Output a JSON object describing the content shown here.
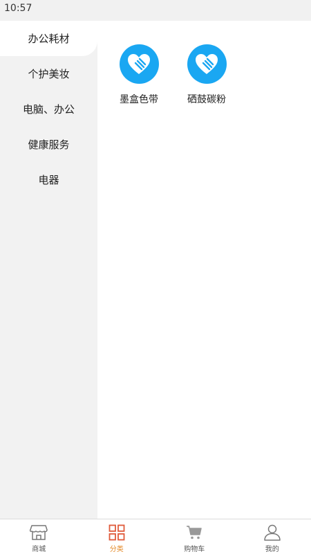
{
  "status_bar": {
    "time": "10:57"
  },
  "sidebar": {
    "items": [
      {
        "label": "办公耗材",
        "active": true
      },
      {
        "label": "个护美妆",
        "active": false
      },
      {
        "label": "电脑、办公",
        "active": false
      },
      {
        "label": "健康服务",
        "active": false
      },
      {
        "label": "电器",
        "active": false
      }
    ]
  },
  "content": {
    "categories": [
      {
        "label": "墨盒色带",
        "icon": "heart-hand-icon"
      },
      {
        "label": "硒鼓碳粉",
        "icon": "heart-hand-icon"
      }
    ]
  },
  "tabbar": {
    "items": [
      {
        "label": "商城",
        "icon": "store-icon",
        "active": false
      },
      {
        "label": "分类",
        "icon": "grid-icon",
        "active": true
      },
      {
        "label": "购物车",
        "icon": "cart-icon",
        "active": false
      },
      {
        "label": "我的",
        "icon": "user-icon",
        "active": false
      }
    ]
  },
  "colors": {
    "accent": "#1aa7f2",
    "tab_active": "#e48b2b",
    "sidebar_bg": "#f2f2f2"
  }
}
